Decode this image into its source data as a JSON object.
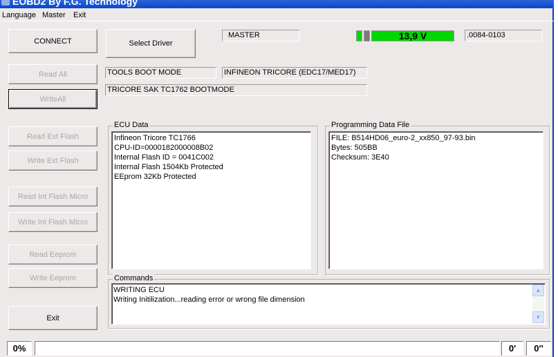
{
  "window": {
    "title": "EOBD2 By F.G. Technology"
  },
  "menu": [
    "Language",
    "Master",
    "Exit"
  ],
  "buttons": {
    "connect": "CONNECT",
    "select_driver": "Select Driver",
    "read_all": "Read All",
    "write_all": "WriteAll",
    "read_ext_flash": "Read Ext Flash",
    "write_ext_flash": "Write Ext Flash",
    "read_int_flash": "Read Int Flash Micro",
    "write_int_flash": "Write Int Flash Micro",
    "read_eeprom": "Read Eeprom",
    "write_eeprom": "Write Eeprom",
    "exit": "Exit"
  },
  "fields": {
    "master": "MASTER",
    "voltage": "13,9 V",
    "version": ".0084-0103",
    "boot_mode": "TOOLS BOOT MODE",
    "ecu_type": "INFINEON TRICORE (EDC17/MED17)",
    "sak": "TRICORE SAK TC1762  BOOTMODE"
  },
  "colors": {
    "voltage_ok": "#00d800",
    "indicator_off": "#7a7a7a"
  },
  "ecu_data": {
    "label": "ECU Data",
    "lines": [
      "Infineon Tricore TC1766",
      "CPU-ID=0000182000008B02",
      "Internal Flash ID = 0041C002",
      "Internal Flash 1504Kb  Protected",
      "EEprom 32Kb  Protected"
    ]
  },
  "programming": {
    "label": "Programming Data File",
    "lines": [
      "FILE: B514HD06_euro-2_xx850_97-93.bin",
      "Bytes: 505BB",
      "Checksum: 3E40"
    ]
  },
  "commands": {
    "label": "Commands",
    "lines": [
      "WRITING ECU",
      "Writing Initilization...reading error or wrong file dimension"
    ]
  },
  "status": {
    "percent": "0%",
    "progress": 0,
    "minutes": "0'",
    "seconds": "0''"
  }
}
